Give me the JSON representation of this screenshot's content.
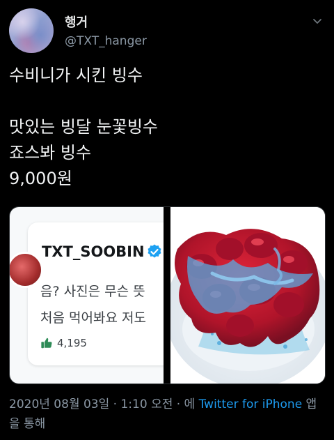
{
  "tweet": {
    "display_name": "행거",
    "handle": "@TXT_hanger",
    "text": "수비니가 시킨 빙수\n\n맛있는 빙달 눈꽃빙수\n죠스봐 빙수\n9,000원"
  },
  "quoted_screenshot": {
    "name": "TXT_SOOBIN",
    "line1": "음? 사진은 무슨 뜻",
    "line2": "처음 먹어봐요 저도",
    "likes": "4,195"
  },
  "footer": {
    "date": "2020년 08월 03일",
    "sep1": " · ",
    "time": "1:10 오전",
    "sep2": " · 에 ",
    "source": "Twitter for iPhone",
    "suffix": " 앱을 통해"
  },
  "icons": {
    "menu": "chevron-down-icon",
    "verified": "verified-badge-icon",
    "like": "thumbs-up-icon"
  },
  "colors": {
    "background": "#000000",
    "link": "#1d9bf0",
    "secondary_text": "#8b98a5",
    "verified": "#1da1f2"
  }
}
